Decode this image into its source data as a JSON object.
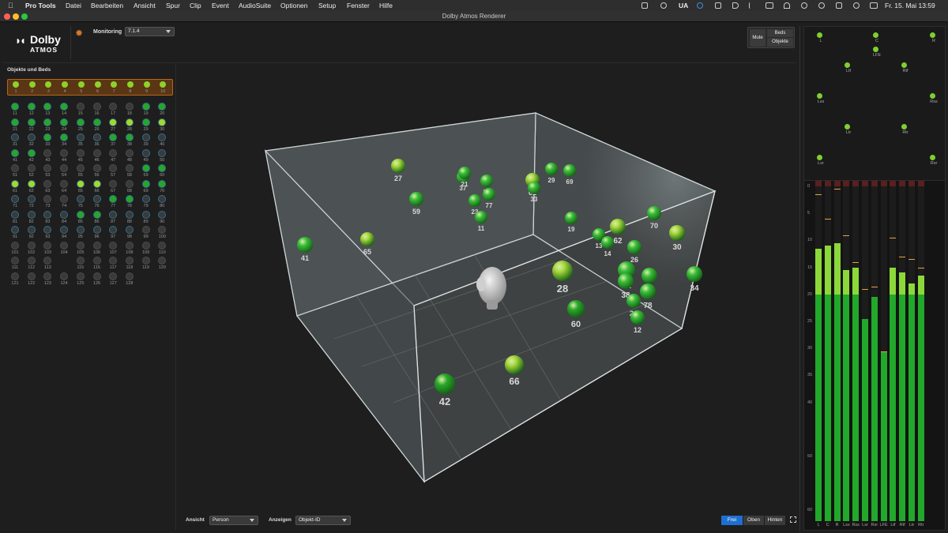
{
  "menubar": {
    "app": "Pro Tools",
    "items": [
      "Datei",
      "Bearbeiten",
      "Ansicht",
      "Spur",
      "Clip",
      "Event",
      "AudioSuite",
      "Optionen",
      "Setup",
      "Fenster",
      "Hilfe"
    ],
    "keyboard": "UA",
    "datetime": "Fr. 15. Mai  13:59"
  },
  "window": {
    "title": "Dolby Atmos Renderer"
  },
  "logo": {
    "brand": "Dolby",
    "sub": "ATMOS"
  },
  "monitoring": {
    "label": "Monitoring",
    "value": "7.1.4"
  },
  "mute": {
    "mute_label": "Mute",
    "beds_label": "Beds",
    "objects_label": "Objekte"
  },
  "objects_panel": {
    "title": "Objekte und Beds",
    "beds": [
      "1",
      "2",
      "3",
      "4",
      "5",
      "6",
      "7",
      "8",
      "9",
      "10"
    ],
    "objects": [
      {
        "id": "11",
        "s": "on",
        "b": 1
      },
      {
        "id": "12",
        "s": "on",
        "b": 1
      },
      {
        "id": "13",
        "s": "on",
        "b": 1
      },
      {
        "id": "14",
        "s": "on",
        "b": 1
      },
      {
        "id": "15",
        "s": "off",
        "b": 0
      },
      {
        "id": "16",
        "s": "off",
        "b": 0
      },
      {
        "id": "17",
        "s": "off",
        "b": 0
      },
      {
        "id": "18",
        "s": "off",
        "b": 0
      },
      {
        "id": "19",
        "s": "on",
        "b": 1
      },
      {
        "id": "20",
        "s": "on",
        "b": 1
      },
      {
        "id": "21",
        "s": "on",
        "b": 1
      },
      {
        "id": "22",
        "s": "on",
        "b": 1
      },
      {
        "id": "23",
        "s": "on",
        "b": 1
      },
      {
        "id": "24",
        "s": "on",
        "b": 1
      },
      {
        "id": "25",
        "s": "on",
        "b": 1
      },
      {
        "id": "26",
        "s": "on",
        "b": 1
      },
      {
        "id": "27",
        "s": "hi",
        "b": 1
      },
      {
        "id": "28",
        "s": "hi",
        "b": 1
      },
      {
        "id": "29",
        "s": "on",
        "b": 1
      },
      {
        "id": "30",
        "s": "hi",
        "b": 1
      },
      {
        "id": "31",
        "s": "off",
        "b": 1
      },
      {
        "id": "32",
        "s": "off",
        "b": 1
      },
      {
        "id": "33",
        "s": "on",
        "b": 1
      },
      {
        "id": "34",
        "s": "on",
        "b": 1
      },
      {
        "id": "35",
        "s": "off",
        "b": 1
      },
      {
        "id": "36",
        "s": "off",
        "b": 1
      },
      {
        "id": "37",
        "s": "on",
        "b": 1
      },
      {
        "id": "38",
        "s": "on",
        "b": 1
      },
      {
        "id": "39",
        "s": "off",
        "b": 1
      },
      {
        "id": "40",
        "s": "off",
        "b": 1
      },
      {
        "id": "41",
        "s": "on",
        "b": 1
      },
      {
        "id": "42",
        "s": "on",
        "b": 1
      },
      {
        "id": "43",
        "s": "off",
        "b": 0
      },
      {
        "id": "44",
        "s": "off",
        "b": 0
      },
      {
        "id": "45",
        "s": "off",
        "b": 0
      },
      {
        "id": "46",
        "s": "off",
        "b": 0
      },
      {
        "id": "47",
        "s": "off",
        "b": 0
      },
      {
        "id": "48",
        "s": "off",
        "b": 0
      },
      {
        "id": "49",
        "s": "off",
        "b": 1
      },
      {
        "id": "50",
        "s": "off",
        "b": 1
      },
      {
        "id": "51",
        "s": "off",
        "b": 0
      },
      {
        "id": "52",
        "s": "off",
        "b": 0
      },
      {
        "id": "53",
        "s": "off",
        "b": 0
      },
      {
        "id": "54",
        "s": "off",
        "b": 0
      },
      {
        "id": "55",
        "s": "off",
        "b": 0
      },
      {
        "id": "56",
        "s": "off",
        "b": 0
      },
      {
        "id": "57",
        "s": "off",
        "b": 0
      },
      {
        "id": "58",
        "s": "off",
        "b": 0
      },
      {
        "id": "59",
        "s": "on",
        "b": 1
      },
      {
        "id": "60",
        "s": "on",
        "b": 1
      },
      {
        "id": "61",
        "s": "hi",
        "b": 1
      },
      {
        "id": "62",
        "s": "hi",
        "b": 1
      },
      {
        "id": "63",
        "s": "off",
        "b": 0
      },
      {
        "id": "64",
        "s": "off",
        "b": 0
      },
      {
        "id": "65",
        "s": "hi",
        "b": 1
      },
      {
        "id": "66",
        "s": "hi",
        "b": 1
      },
      {
        "id": "67",
        "s": "off",
        "b": 0
      },
      {
        "id": "68",
        "s": "off",
        "b": 0
      },
      {
        "id": "69",
        "s": "on",
        "b": 1
      },
      {
        "id": "70",
        "s": "on",
        "b": 1
      },
      {
        "id": "71",
        "s": "off",
        "b": 1
      },
      {
        "id": "72",
        "s": "off",
        "b": 1
      },
      {
        "id": "73",
        "s": "off",
        "b": 0
      },
      {
        "id": "74",
        "s": "off",
        "b": 0
      },
      {
        "id": "75",
        "s": "off",
        "b": 1
      },
      {
        "id": "76",
        "s": "off",
        "b": 1
      },
      {
        "id": "77",
        "s": "on",
        "b": 1
      },
      {
        "id": "78",
        "s": "on",
        "b": 1
      },
      {
        "id": "79",
        "s": "off",
        "b": 1
      },
      {
        "id": "80",
        "s": "off",
        "b": 1
      },
      {
        "id": "81",
        "s": "off",
        "b": 1
      },
      {
        "id": "82",
        "s": "off",
        "b": 1
      },
      {
        "id": "83",
        "s": "off",
        "b": 1
      },
      {
        "id": "84",
        "s": "off",
        "b": 1
      },
      {
        "id": "85",
        "s": "on",
        "b": 1
      },
      {
        "id": "86",
        "s": "on",
        "b": 1
      },
      {
        "id": "87",
        "s": "off",
        "b": 1
      },
      {
        "id": "88",
        "s": "off",
        "b": 1
      },
      {
        "id": "89",
        "s": "off",
        "b": 1
      },
      {
        "id": "90",
        "s": "off",
        "b": 1
      },
      {
        "id": "91",
        "s": "off",
        "b": 1
      },
      {
        "id": "92",
        "s": "off",
        "b": 1
      },
      {
        "id": "93",
        "s": "off",
        "b": 1
      },
      {
        "id": "94",
        "s": "off",
        "b": 1
      },
      {
        "id": "95",
        "s": "off",
        "b": 1
      },
      {
        "id": "96",
        "s": "off",
        "b": 1
      },
      {
        "id": "97",
        "s": "off",
        "b": 1
      },
      {
        "id": "98",
        "s": "off",
        "b": 1
      },
      {
        "id": "99",
        "s": "off",
        "b": 0
      },
      {
        "id": "100",
        "s": "off",
        "b": 0
      },
      {
        "id": "101",
        "s": "off",
        "b": 0
      },
      {
        "id": "102",
        "s": "off",
        "b": 0
      },
      {
        "id": "103",
        "s": "off",
        "b": 0
      },
      {
        "id": "104",
        "s": "off",
        "b": 0
      },
      {
        "id": "105",
        "s": "off",
        "b": 0
      },
      {
        "id": "106",
        "s": "off",
        "b": 0
      },
      {
        "id": "107",
        "s": "off",
        "b": 0
      },
      {
        "id": "108",
        "s": "off",
        "b": 0
      },
      {
        "id": "109",
        "s": "off",
        "b": 0
      },
      {
        "id": "110",
        "s": "off",
        "b": 0
      },
      {
        "id": "111",
        "s": "off",
        "b": 0
      },
      {
        "id": "112",
        "s": "off",
        "b": 0
      },
      {
        "id": "113",
        "s": "off",
        "b": 0
      },
      {
        "id": "115",
        "s": "off",
        "b": 0
      },
      {
        "id": "116",
        "s": "off",
        "b": 0
      },
      {
        "id": "117",
        "s": "off",
        "b": 0
      },
      {
        "id": "118",
        "s": "off",
        "b": 0
      },
      {
        "id": "119",
        "s": "off",
        "b": 0
      },
      {
        "id": "120",
        "s": "off",
        "b": 0
      },
      {
        "id": "121",
        "s": "off",
        "b": 0
      },
      {
        "id": "122",
        "s": "off",
        "b": 0
      },
      {
        "id": "123",
        "s": "off",
        "b": 0
      },
      {
        "id": "124",
        "s": "off",
        "b": 0
      },
      {
        "id": "125",
        "s": "off",
        "b": 0
      },
      {
        "id": "126",
        "s": "off",
        "b": 0
      },
      {
        "id": "127",
        "s": "off",
        "b": 0
      },
      {
        "id": "128",
        "s": "off",
        "b": 0
      }
    ]
  },
  "scene_objects": [
    {
      "id": "27",
      "c": "#a6d63c"
    },
    {
      "id": "59",
      "c": "#3bbf3b"
    },
    {
      "id": "37",
      "c": "#3bbf3b"
    },
    {
      "id": "21",
      "c": "#3bbf3b"
    },
    {
      "id": "85",
      "c": "#3bbf3b"
    },
    {
      "id": "77",
      "c": "#3bbf3b"
    },
    {
      "id": "23",
      "c": "#3bbf3b"
    },
    {
      "id": "11",
      "c": "#3bbf3b"
    },
    {
      "id": "61",
      "c": "#a6d63c"
    },
    {
      "id": "33",
      "c": "#3bbf3b"
    },
    {
      "id": "29",
      "c": "#3bbf3b"
    },
    {
      "id": "69",
      "c": "#3bbf3b"
    },
    {
      "id": "41",
      "c": "#3bbf3b"
    },
    {
      "id": "65",
      "c": "#a6d63c"
    },
    {
      "id": "19",
      "c": "#3bbf3b"
    },
    {
      "id": "13",
      "c": "#3bbf3b"
    },
    {
      "id": "14",
      "c": "#3bbf3b"
    },
    {
      "id": "62",
      "c": "#a6d63c"
    },
    {
      "id": "26",
      "c": "#3bbf3b"
    },
    {
      "id": "70",
      "c": "#3bbf3b"
    },
    {
      "id": "30",
      "c": "#a6d63c"
    },
    {
      "id": "22",
      "c": "#3bbf3b"
    },
    {
      "id": "38",
      "c": "#3bbf3b"
    },
    {
      "id": "86",
      "c": "#3bbf3b"
    },
    {
      "id": "78",
      "c": "#3bbf3b"
    },
    {
      "id": "24",
      "c": "#3bbf3b"
    },
    {
      "id": "12",
      "c": "#3bbf3b"
    },
    {
      "id": "34",
      "c": "#3bbf3b"
    },
    {
      "id": "28",
      "c": "#a6d63c"
    },
    {
      "id": "60",
      "c": "#2ba82b"
    },
    {
      "id": "66",
      "c": "#a6d63c"
    },
    {
      "id": "42",
      "c": "#2ba82b"
    }
  ],
  "bottombar": {
    "view_label": "Ansicht",
    "view_value": "Person",
    "show_label": "Anzeigen",
    "show_value": "Objekt-ID",
    "buttons": [
      "Frei",
      "Oben",
      "Hinten"
    ],
    "active": "Frei"
  },
  "speakers": [
    "L",
    "C",
    "R",
    "LFE",
    "Ltf",
    "Rtf",
    "Lss",
    "Rss",
    "Ltr",
    "Rtr",
    "Lsr",
    "Rsr"
  ],
  "meters": {
    "scale": [
      "0",
      "5",
      "10",
      "15",
      "20",
      "25",
      "30",
      "35",
      "40",
      "50",
      "60"
    ],
    "channels": [
      {
        "name": "L",
        "level": -11.5,
        "peak": -1.5
      },
      {
        "name": "C",
        "level": -11,
        "peak": -6
      },
      {
        "name": "R",
        "level": -10.5,
        "peak": -0.5
      },
      {
        "name": "Lss",
        "level": -15.5,
        "peak": -9
      },
      {
        "name": "Rss",
        "level": -15,
        "peak": -14
      },
      {
        "name": "Lsr",
        "level": -24.5,
        "peak": -19
      },
      {
        "name": "Rsr",
        "level": -20.5,
        "peak": -18.5
      },
      {
        "name": "LFE",
        "level": -30.5,
        "peak": -30.5
      },
      {
        "name": "Ltf",
        "level": -15,
        "peak": -9.5
      },
      {
        "name": "Rtf",
        "level": -16,
        "peak": -13
      },
      {
        "name": "Ltr",
        "level": -18,
        "peak": -13.5
      },
      {
        "name": "Rtr",
        "level": -16.5,
        "peak": -15
      }
    ]
  }
}
